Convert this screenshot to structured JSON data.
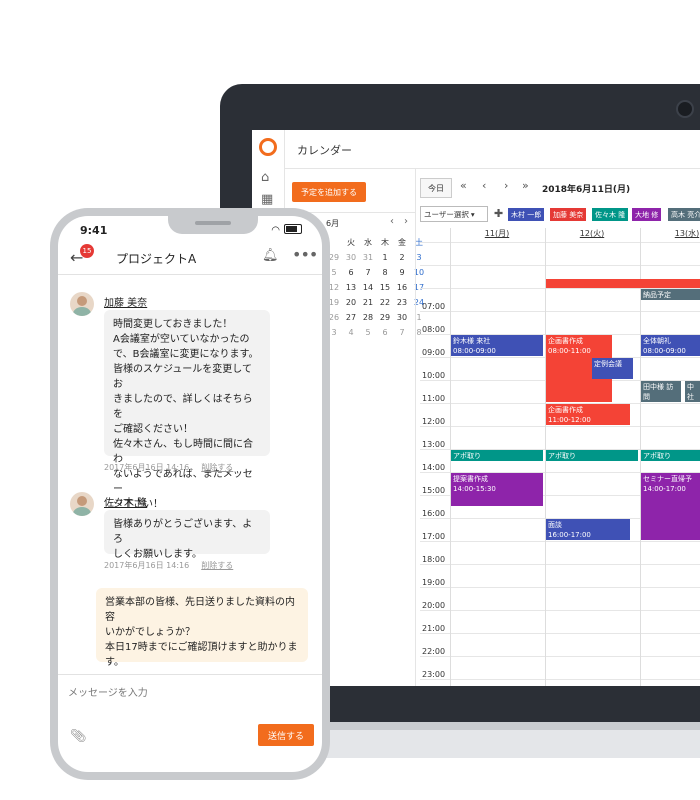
{
  "desktop": {
    "header_title": "カレンダー",
    "add_button": "予定を追加する",
    "mini_calendar": {
      "month": "6月",
      "weekdays": [
        "火",
        "水",
        "木",
        "金",
        "土"
      ],
      "first_col": "月",
      "rows": [
        [
          "29",
          "30",
          "31",
          "1",
          "2",
          "3"
        ],
        [
          "5",
          "6",
          "7",
          "8",
          "9",
          "10"
        ],
        [
          "12",
          "13",
          "14",
          "15",
          "16",
          "17"
        ],
        [
          "19",
          "20",
          "21",
          "22",
          "23",
          "24"
        ],
        [
          "26",
          "27",
          "28",
          "29",
          "30",
          "1"
        ],
        [
          "3",
          "4",
          "5",
          "6",
          "7",
          "8"
        ]
      ]
    },
    "today_button": "今日",
    "current_date": "2018年6月11日(月)",
    "user_select": "ユーザー選択",
    "user_tags": [
      {
        "name": "木村 一郎",
        "color": "#3f51b5"
      },
      {
        "name": "加藤 美奈",
        "color": "#e53935"
      },
      {
        "name": "佐々木 隆",
        "color": "#009688"
      },
      {
        "name": "大地 修",
        "color": "#8e24aa"
      },
      {
        "name": "高木 亮介",
        "color": "#546e7a"
      }
    ],
    "day_headers": [
      "11(月)",
      "12(火)",
      "13(水)"
    ],
    "hours": [
      "07:00",
      "08:00",
      "09:00",
      "10:00",
      "11:00",
      "12:00",
      "13:00",
      "14:00",
      "15:00",
      "16:00",
      "17:00",
      "18:00",
      "19:00",
      "20:00",
      "21:00",
      "22:00",
      "23:00"
    ],
    "events": {
      "e1": {
        "title": "鈴木様 来社",
        "time": "08:00-09:00",
        "color": "#3f51b5"
      },
      "e2": {
        "title": "企画書作成",
        "time": "08:00-11:00",
        "color": "#f44336"
      },
      "e3": {
        "title": "定例会議",
        "time": "",
        "color": "#3f51b5"
      },
      "e4": {
        "title": "企画書作成",
        "time": "11:00-12:00",
        "color": "#f44336"
      },
      "e5": {
        "title": "全体朝礼",
        "time": "08:00-09:00",
        "color": "#3f51b5"
      },
      "e6": {
        "title": "納品予定",
        "time": "",
        "color": "#546e7a"
      },
      "e7": {
        "title": "田中様 訪問",
        "time": "10:00-11:00",
        "color": "#546e7a"
      },
      "e8": {
        "title": "中",
        "time": "社",
        "color": "#546e7a"
      },
      "e9": {
        "title": "アポ取り",
        "time": "13:00",
        "color": "#009688"
      },
      "e10": {
        "title": "アポ取り",
        "time": "13:00",
        "color": "#009688"
      },
      "e11": {
        "title": "アポ取り",
        "time": "13:00",
        "color": "#009688"
      },
      "e12": {
        "title": "提案書作成",
        "time": "14:00-15:30",
        "color": "#8e24aa"
      },
      "e13": {
        "title": "セミナー直帰予",
        "time": "14:00-17:00",
        "color": "#8e24aa"
      },
      "e14": {
        "title": "面談",
        "time": "16:00-17:00",
        "color": "#3f51b5"
      }
    }
  },
  "phone": {
    "time": "9:41",
    "badge_count": "15",
    "title": "プロジェクトA",
    "messages": [
      {
        "user": "加藤 美奈",
        "text": "時間変更しておきました！\nA会議室が空いていなかったの\nで、B会議室に変更になります。\n皆様のスケジュールを変更してお\nきましたので、詳しくはそちらを\nご確認ください！\n佐々木さん、もし時間に間に合わ\nないようであれば、またメッセー\nジ下さい！",
        "timestamp": "2017年6月16日 14:16",
        "delete": "削除する"
      },
      {
        "user": "佐々木 隆",
        "text": "皆様ありがとうございます、よろ\nしくお願いします。",
        "timestamp": "2017年6月16日 14:16",
        "delete": "削除する"
      }
    ],
    "my_message": "営業本部の皆様、先日送りました資料の内容\nいかがでしょうか？\n本日17時までにご確認頂けますと助かりま\nす。",
    "input_placeholder": "メッセージを入力",
    "send_button": "送信する"
  }
}
